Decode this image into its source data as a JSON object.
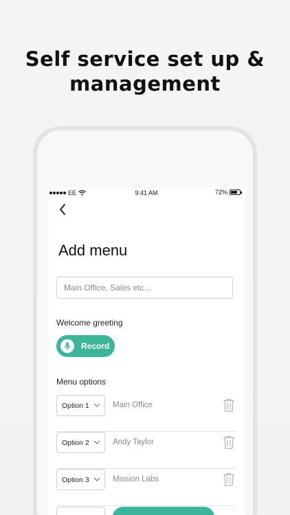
{
  "headline": {
    "line1": "Self service set up &",
    "line2": "management"
  },
  "statusbar": {
    "carrier": "EE",
    "time": "9:41 AM",
    "battery": "72%",
    "battery_level": 0.72
  },
  "screen": {
    "back_icon": "chevron-left-icon",
    "title": "Add menu",
    "name_placeholder": "Main Office, Sales etc...",
    "welcome_label": "Welcome greeting",
    "record_label": "Record",
    "menu_options_label": "Menu options",
    "options": [
      {
        "select": "Option 1",
        "name": "Main Office"
      },
      {
        "select": "Option 2",
        "name": "Andy Taylor"
      },
      {
        "select": "Option 3",
        "name": "Mission Labs"
      }
    ]
  },
  "colors": {
    "accent": "#3db59a",
    "muted_text": "#888888",
    "icon_gray": "#b5b5b5"
  }
}
